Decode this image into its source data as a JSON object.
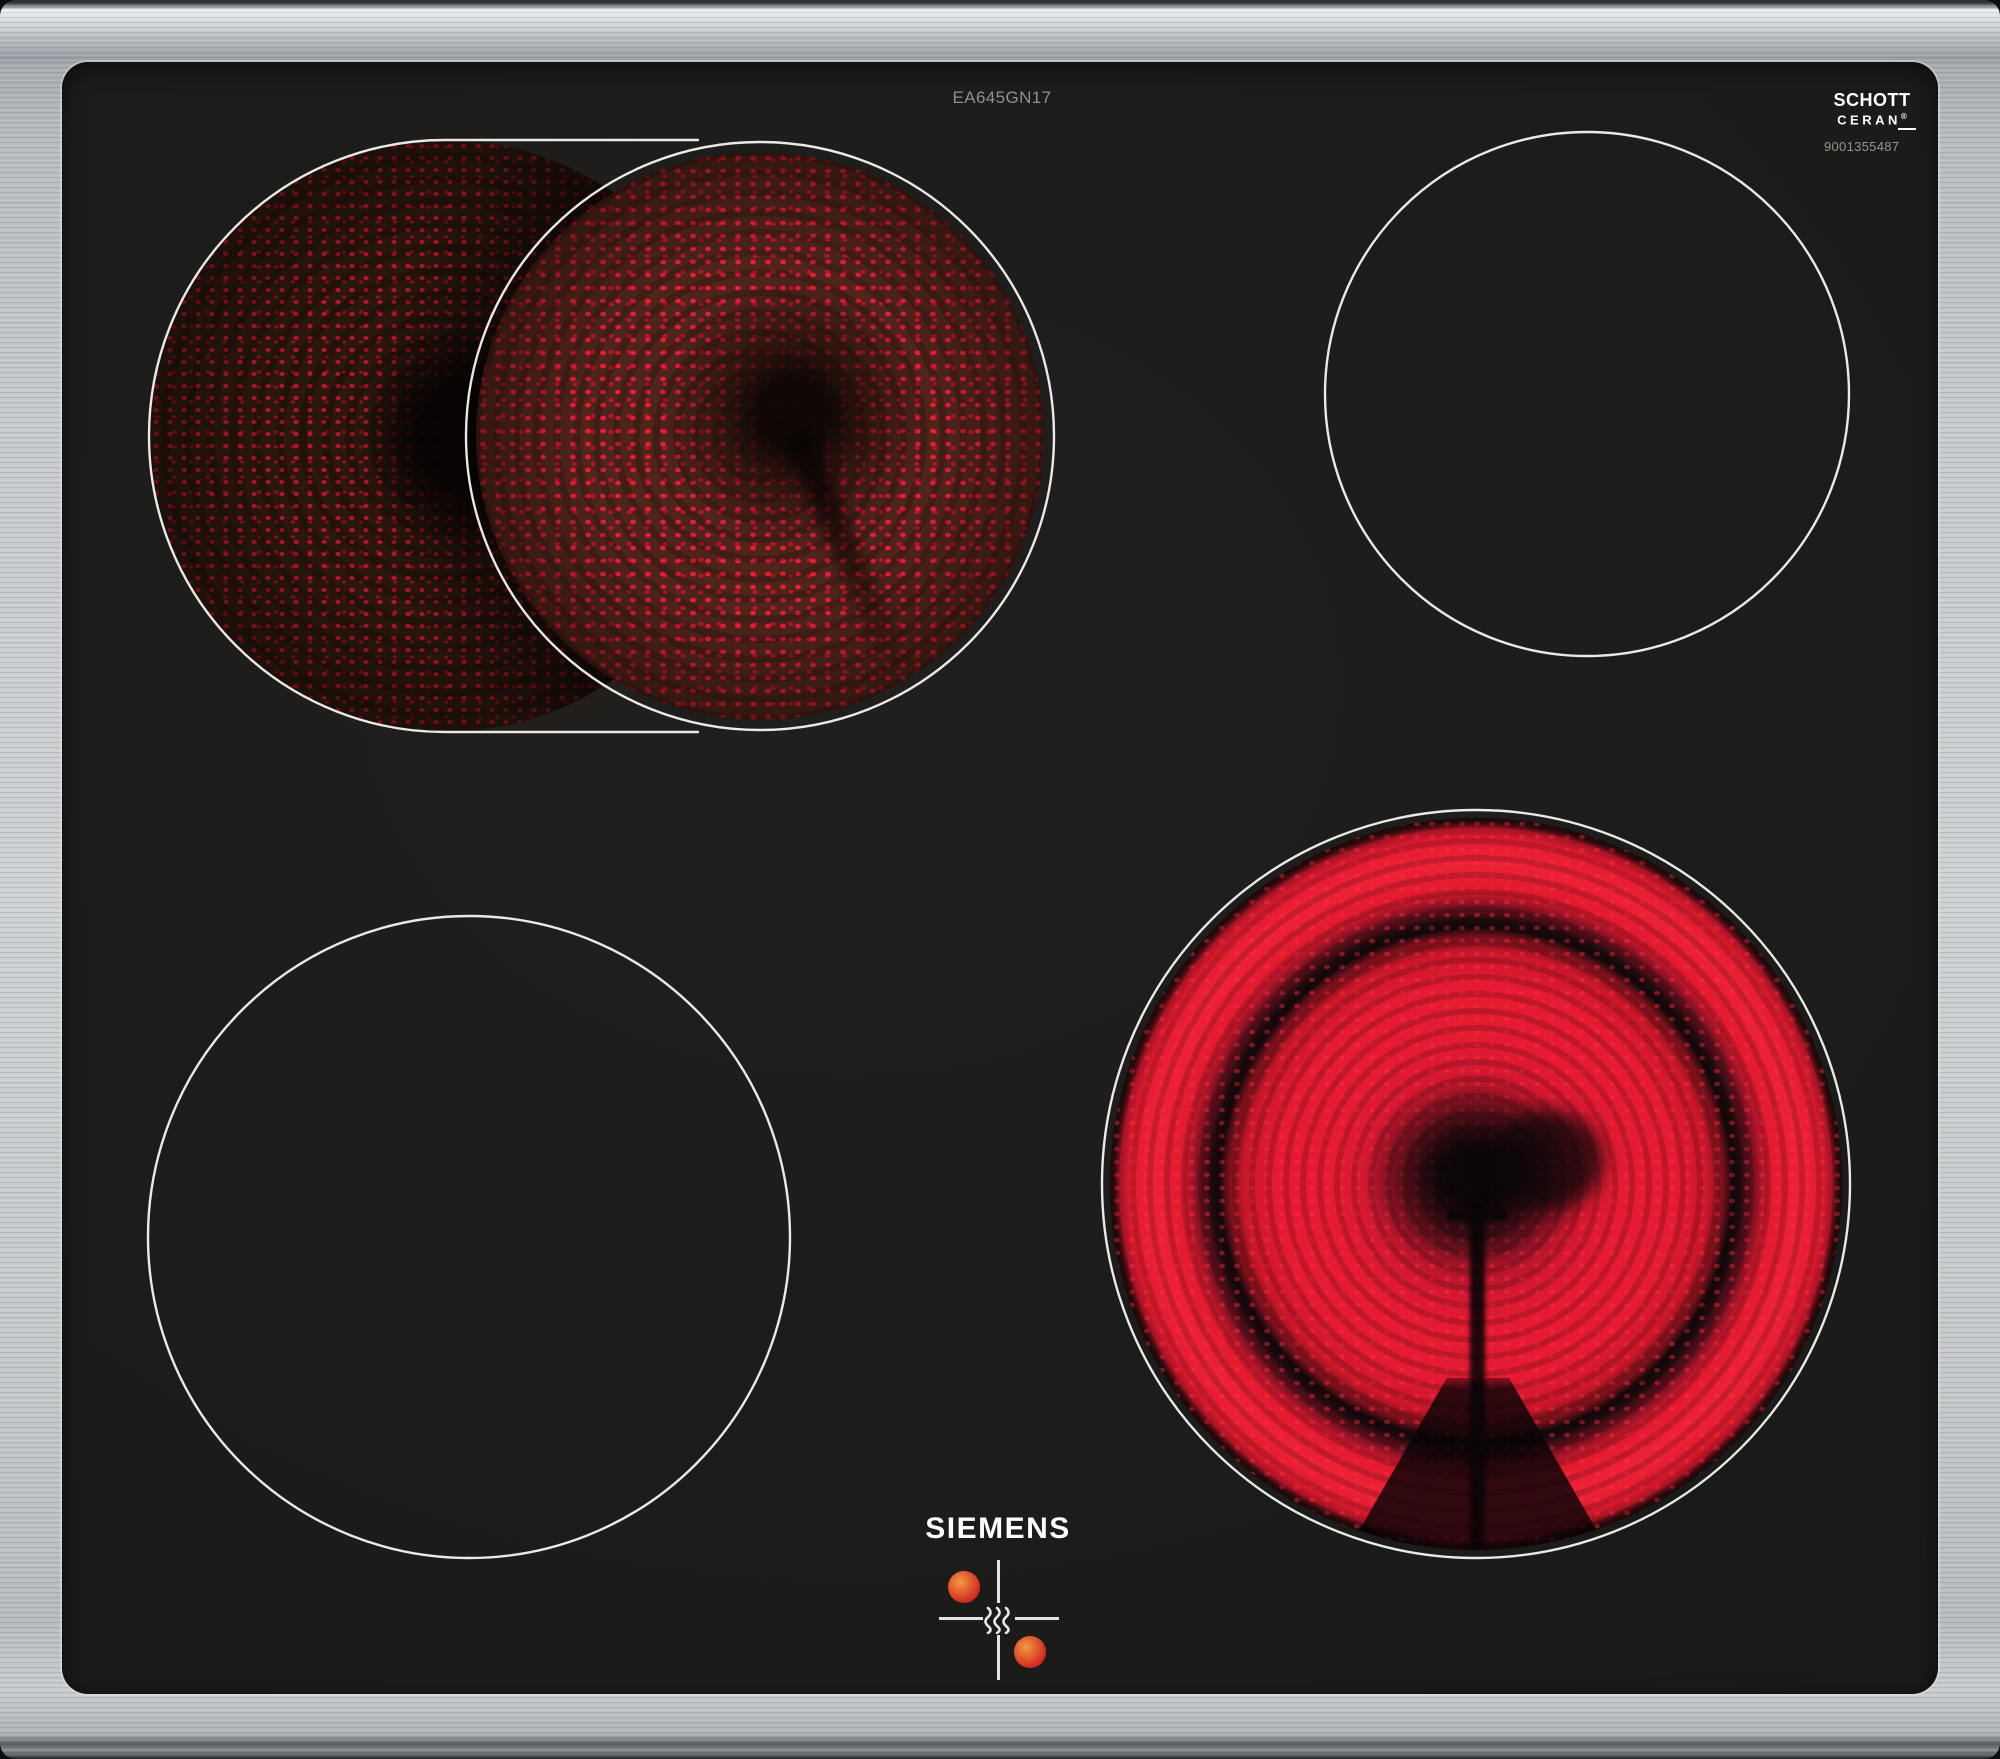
{
  "branding": {
    "manufacturer_logo": "SIEMENS",
    "model_code": "EA645GN17",
    "glass_logo_line1": "SCHOTT",
    "glass_logo_line2": "CERAN",
    "glass_logo_reg": "®",
    "print_number": "9001355487"
  },
  "colors": {
    "frame_metal": "#c7cbcf",
    "glass_black": "#1b1b19",
    "marking_white": "#f4f4f2",
    "element_glow_red": "#e41b31",
    "element_dot_red": "#ee1b34",
    "residual_dot_orange": "#e2622e"
  },
  "zones": {
    "rear_left": {
      "name": "dual-extension-zone",
      "state": "on"
    },
    "rear_right": {
      "name": "standard-zone",
      "state": "off"
    },
    "front_left": {
      "name": "standard-zone",
      "state": "off"
    },
    "front_right": {
      "name": "dual-circuit-zone",
      "state": "on"
    }
  },
  "indicator": {
    "type": "residual-heat-crosshair",
    "dots": 2
  }
}
